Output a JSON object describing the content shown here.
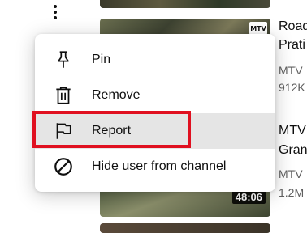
{
  "videos": [
    {
      "title_lines": [
        "Road",
        "Prati"
      ],
      "channel": "MTV",
      "views": "912K",
      "logo_text": "MTV"
    },
    {
      "title_lines": [
        "MTV",
        "Gran"
      ],
      "channel": "MTV",
      "views": "1.2M",
      "duration": "48:06"
    }
  ],
  "menu": {
    "items": [
      {
        "label": "Pin",
        "icon": "pin-icon"
      },
      {
        "label": "Remove",
        "icon": "trash-icon"
      },
      {
        "label": "Report",
        "icon": "flag-icon"
      },
      {
        "label": "Hide user from channel",
        "icon": "block-icon"
      }
    ]
  },
  "colors": {
    "highlight": "#e01020",
    "hover_background": "#e5e5e5",
    "text": "#0f0f0f",
    "meta_text": "#606060"
  }
}
